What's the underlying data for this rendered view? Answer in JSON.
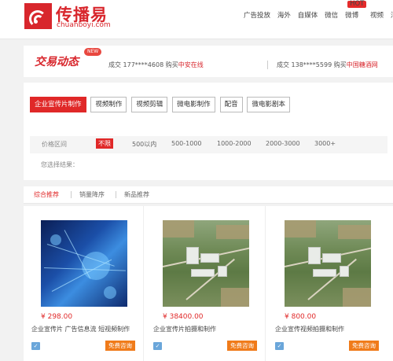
{
  "header": {
    "logo_name": "传播易",
    "logo_domain": "chuanboyi.com",
    "nav": [
      "广告投放",
      "海外",
      "自媒体",
      "微信",
      "微博",
      "视频",
      "活"
    ],
    "hot_badge": "HOT"
  },
  "ticker": {
    "title": "交易动态",
    "new_badge": "NEW",
    "deals": [
      {
        "text": "成交 177****4608 购买",
        "product": "中安在线"
      },
      {
        "text": "成交 138****5599 购买",
        "product": "中国糖酒网"
      }
    ]
  },
  "categories": [
    "企业宣传片制作",
    "视频制作",
    "视频剪辑",
    "微电影制作",
    "配音",
    "微电影剧本"
  ],
  "price_filter": {
    "label": "价格区间",
    "options": [
      "不限",
      "500以内",
      "500-1000",
      "1000-2000",
      "2000-3000",
      "3000+"
    ],
    "selected_label": "您选择结果："
  },
  "sort_tabs": [
    "综合推荐",
    "销量降序",
    "新品推荐"
  ],
  "products": [
    {
      "price": "¥ 298.00",
      "name": "企业宣传片 广告信息流 短视频制作",
      "image": "tech-network-image",
      "button": "免费咨询",
      "icon": "service-icon"
    },
    {
      "price": "¥ 38400.00",
      "name": "企业宣传片拍摄和制作",
      "image": "aerial-factory-image",
      "button": "免费咨询",
      "icon": "service-icon"
    },
    {
      "price": "¥ 800.00",
      "name": "企业宣传视频拍摄和制作",
      "image": "aerial-factory-image",
      "button": "免费咨询",
      "icon": "service-icon"
    }
  ],
  "colors": {
    "brand": "#d8262c",
    "active": "#e02828",
    "consult": "#f07b1a"
  }
}
